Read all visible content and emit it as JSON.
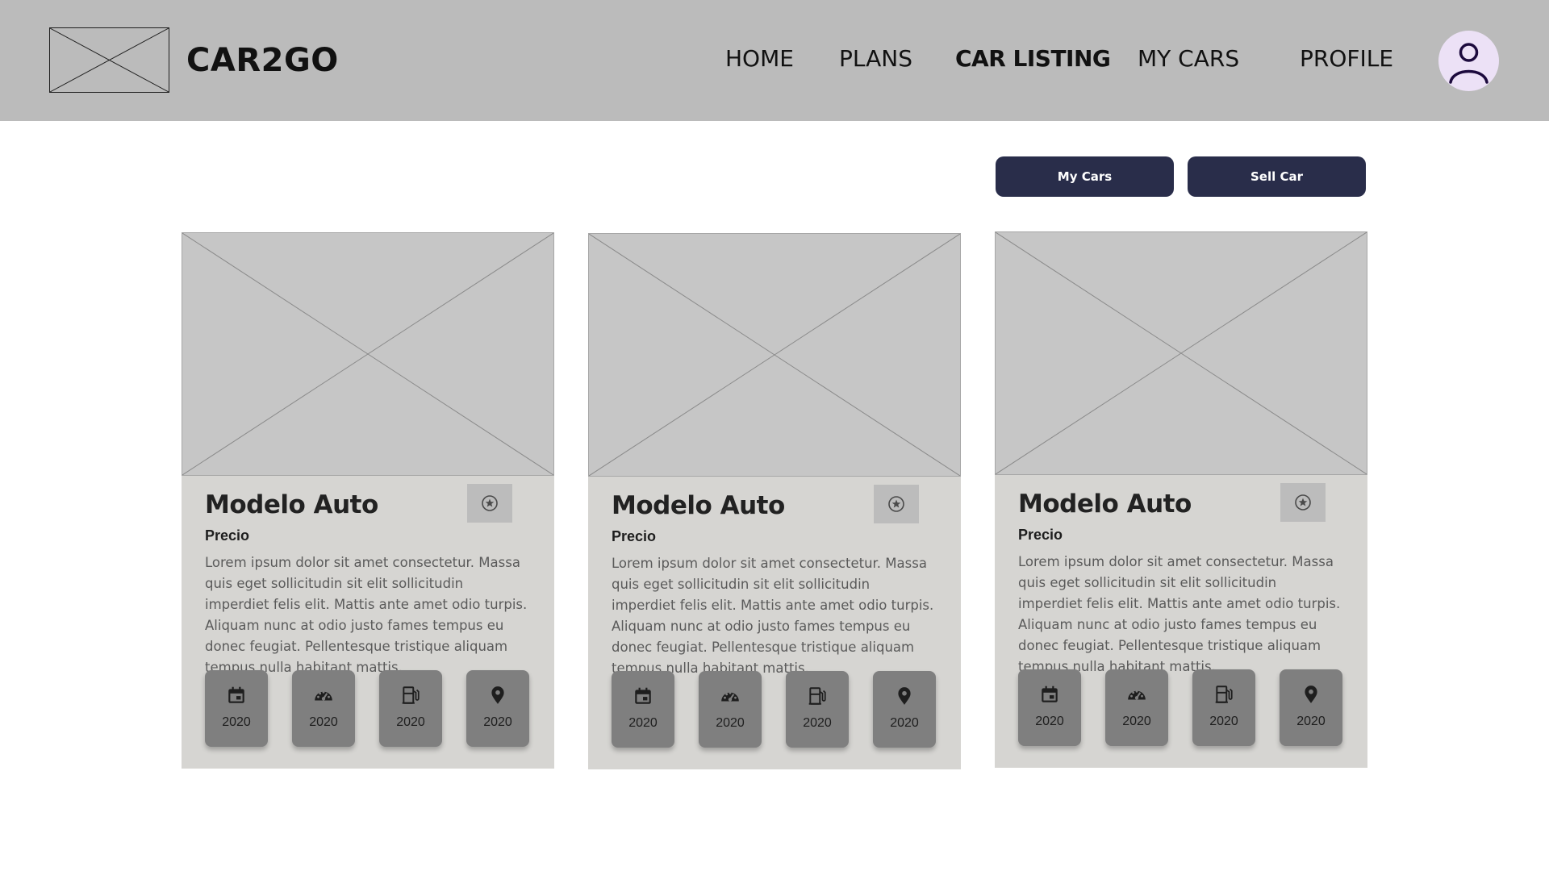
{
  "header": {
    "brand": "CAR2GO",
    "nav": [
      {
        "label": "HOME"
      },
      {
        "label": "PLANS"
      },
      {
        "label": "CAR LISTING",
        "active": true
      },
      {
        "label": "MY CARS"
      },
      {
        "label": "PROFILE"
      }
    ],
    "avatar_icon": "user-icon"
  },
  "actions": {
    "my_cars": "My Cars",
    "sell_car": "Sell Car"
  },
  "cards": [
    {
      "title": "Modelo Auto",
      "price": "Precio",
      "description": "Lorem ipsum dolor sit amet consectetur. Massa quis eget sollicitudin sit elit sollicitudin imperdiet felis elit. Mattis ante amet odio turpis. Aliquam nunc at odio justo fames tempus eu donec feugiat. Pellentesque tristique aliquam tempus nulla habitant mattis.",
      "specs": [
        {
          "icon": "calendar-icon",
          "value": "2020"
        },
        {
          "icon": "speedometer-icon",
          "value": "2020"
        },
        {
          "icon": "fuel-icon",
          "value": "2020"
        },
        {
          "icon": "location-icon",
          "value": "2020"
        }
      ]
    },
    {
      "title": "Modelo Auto",
      "price": "Precio",
      "description": "Lorem ipsum dolor sit amet consectetur. Massa quis eget sollicitudin sit elit sollicitudin imperdiet felis elit. Mattis ante amet odio turpis. Aliquam nunc at odio justo fames tempus eu donec feugiat. Pellentesque tristique aliquam tempus nulla habitant mattis.",
      "specs": [
        {
          "icon": "calendar-icon",
          "value": "2020"
        },
        {
          "icon": "speedometer-icon",
          "value": "2020"
        },
        {
          "icon": "fuel-icon",
          "value": "2020"
        },
        {
          "icon": "location-icon",
          "value": "2020"
        }
      ]
    },
    {
      "title": "Modelo Auto",
      "price": "Precio",
      "description": "Lorem ipsum dolor sit amet consectetur. Massa quis eget sollicitudin sit elit sollicitudin imperdiet felis elit. Mattis ante amet odio turpis. Aliquam nunc at odio justo fames tempus eu donec feugiat. Pellentesque tristique aliquam tempus nulla habitant mattis.",
      "specs": [
        {
          "icon": "calendar-icon",
          "value": "2020"
        },
        {
          "icon": "speedometer-icon",
          "value": "2020"
        },
        {
          "icon": "fuel-icon",
          "value": "2020"
        },
        {
          "icon": "location-icon",
          "value": "2020"
        }
      ]
    }
  ],
  "colors": {
    "header_bg": "#bbbbbb",
    "button_bg": "#292d4a",
    "card_bg": "#d6d5d2",
    "spec_bg": "#7f7f7f",
    "avatar_bg": "#ece1f6"
  }
}
